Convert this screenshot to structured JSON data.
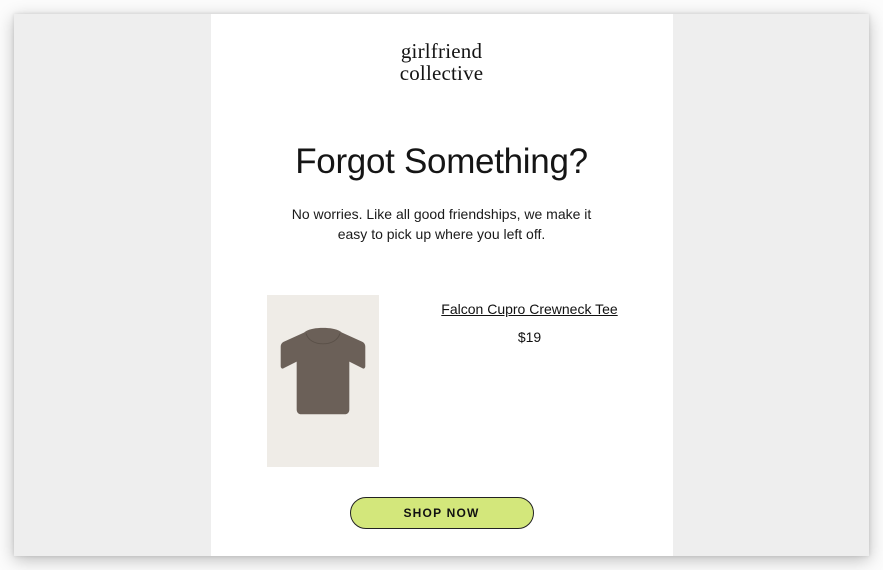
{
  "brand": {
    "line1": "girlfriend",
    "line2": "collective"
  },
  "heading": "Forgot Something?",
  "subheading": "No worries. Like all good friendships, we make it easy to pick up where you left off.",
  "product": {
    "name": "Falcon Cupro Crewneck Tee",
    "price": "$19"
  },
  "cta": {
    "label": "SHOP NOW"
  },
  "colors": {
    "accent": "#d3e77b",
    "product_garment": "#6b6058",
    "product_bg": "#efece7"
  }
}
